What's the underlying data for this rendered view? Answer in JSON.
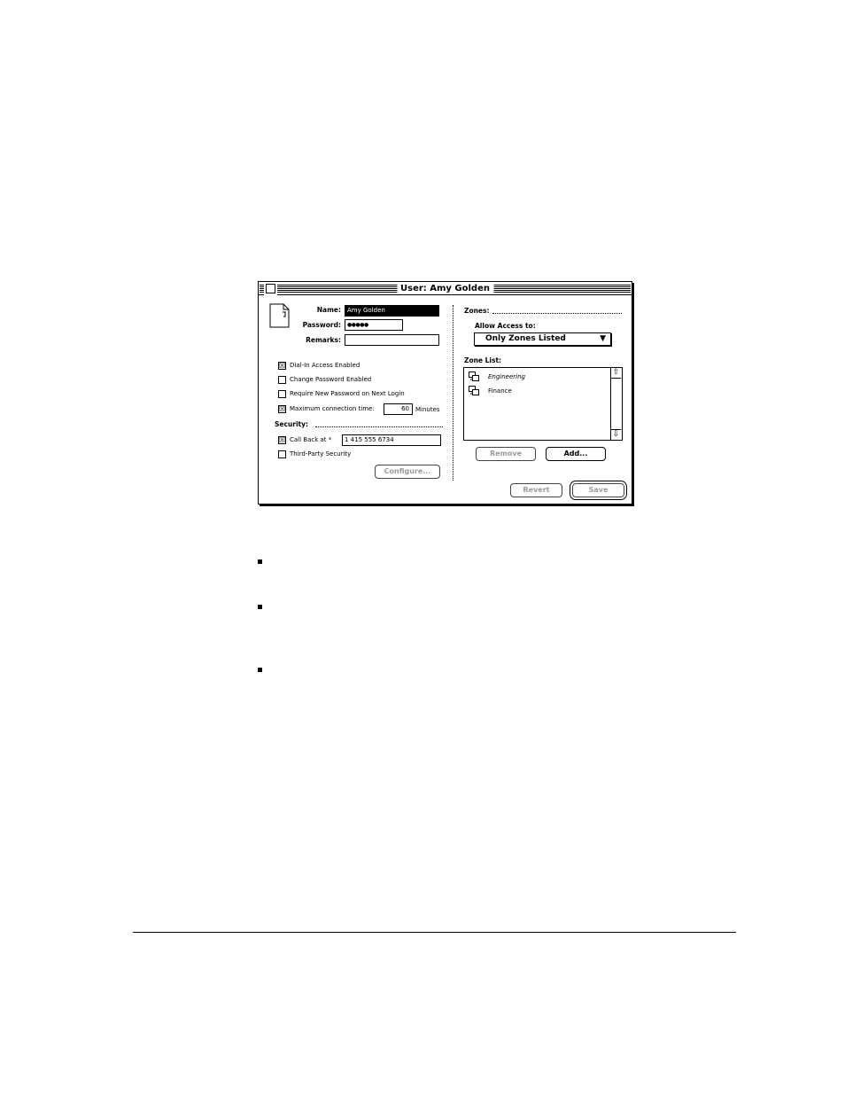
{
  "window": {
    "title": "User: Amy Golden"
  },
  "user": {
    "name_label": "Name:",
    "name_value": "Amy Golden",
    "password_label": "Password:",
    "password_value": "●●●●●",
    "remarks_label": "Remarks:",
    "remarks_value": ""
  },
  "options": {
    "dialin_label": "Dial-In Access Enabled",
    "dialin_checked": "☒",
    "change_pw_label": "Change Password Enabled",
    "require_pw_label": "Require New Password on Next Login",
    "max_time_label": "Maximum connection time:",
    "max_time_checked": "☒",
    "max_time_value": "60",
    "max_time_unit": "Minutes"
  },
  "security": {
    "heading": "Security:",
    "callback_label": "Call Back at *",
    "callback_value": "1 415 555 6734",
    "third_party_label": "Third-Party Security",
    "configure_button": "Configure..."
  },
  "zones": {
    "heading": "Zones:",
    "allow_label": "Allow Access to:",
    "allow_selected": "Only Zones Listed",
    "list_label": "Zone List:",
    "items": [
      "Engineering",
      "Finance"
    ],
    "remove_button": "Remove",
    "add_button": "Add..."
  },
  "footer": {
    "revert_button": "Revert",
    "save_button": "Save"
  }
}
